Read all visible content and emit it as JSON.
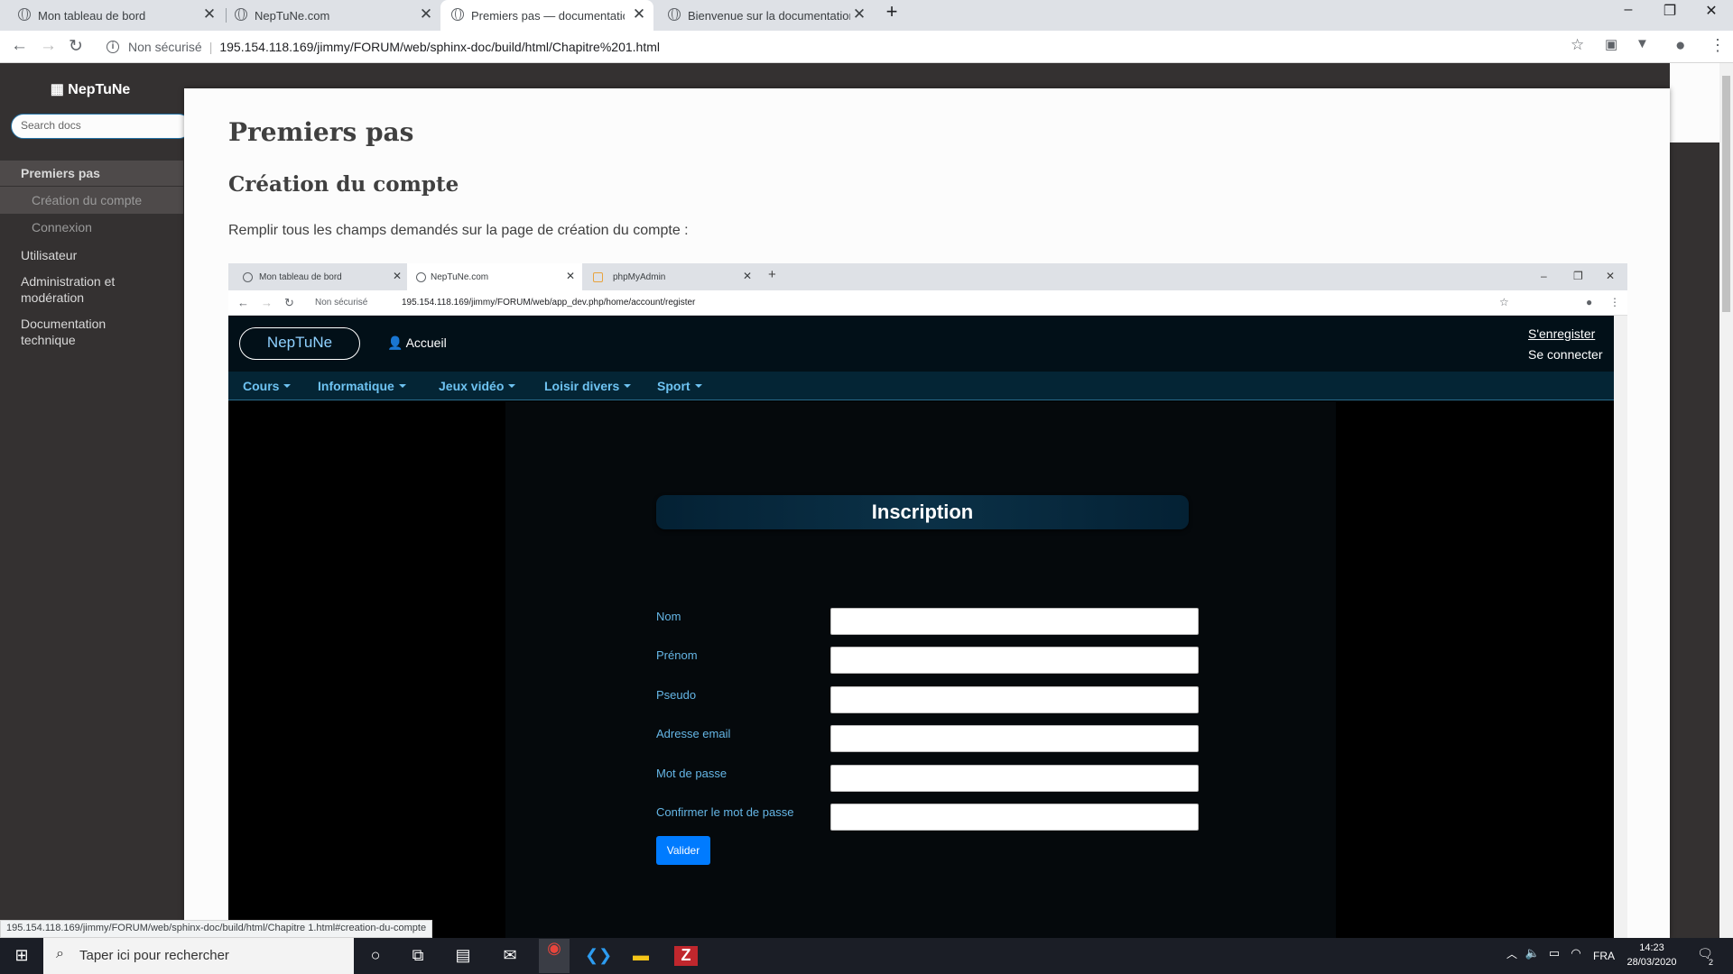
{
  "browser": {
    "tabs": [
      {
        "title": "Mon tableau de bord"
      },
      {
        "title": "NepTuNe.com"
      },
      {
        "title": "Premiers pas — documentation NepTuNe"
      },
      {
        "title": "Bienvenue sur la documentation"
      }
    ],
    "security": "Non sécurisé",
    "url": "195.154.118.169/jimmy/FORUM/web/sphinx-doc/build/html/Chapitre%201.html"
  },
  "sidebar": {
    "brand": "NepTuNe",
    "search_placeholder": "Search docs",
    "items": [
      {
        "label": "Premiers pas"
      },
      {
        "label": "Création du compte"
      },
      {
        "label": "Connexion"
      },
      {
        "label": "Utilisateur"
      },
      {
        "label": "Administration et modération"
      },
      {
        "label": "Documentation technique"
      }
    ]
  },
  "content": {
    "title": "Premiers pas",
    "section": "Création du compte",
    "intro": "Remplir tous les champs demandés sur la page de création du compte :"
  },
  "inner": {
    "tabs": [
      {
        "title": "Mon tableau de bord"
      },
      {
        "title": "NepTuNe.com"
      },
      {
        "title": "phpMyAdmin"
      }
    ],
    "security": "Non sécurisé",
    "url": "195.154.118.169/jimmy/FORUM/web/app_dev.php/home/account/register",
    "site": {
      "logo": "NepTuNe",
      "home": "Accueil",
      "register": "S'enregister",
      "login": "Se connecter",
      "menu": [
        {
          "label": "Cours"
        },
        {
          "label": "Informatique"
        },
        {
          "label": "Jeux vidéo"
        },
        {
          "label": "Loisir divers"
        },
        {
          "label": "Sport"
        }
      ],
      "form_title": "Inscription",
      "fields": [
        {
          "label": "Nom"
        },
        {
          "label": "Prénom"
        },
        {
          "label": "Pseudo"
        },
        {
          "label": "Adresse email"
        },
        {
          "label": "Mot de passe"
        },
        {
          "label": "Confirmer le mot de passe"
        }
      ],
      "submit": "Valider"
    }
  },
  "statusbar": "195.154.118.169/jimmy/FORUM/web/sphinx-doc/build/html/Chapitre 1.html#creation-du-compte",
  "taskbar": {
    "search": "Taper ici pour rechercher",
    "lang": "FRA",
    "time": "14:23",
    "date": "28/03/2020",
    "notifications": "2"
  }
}
